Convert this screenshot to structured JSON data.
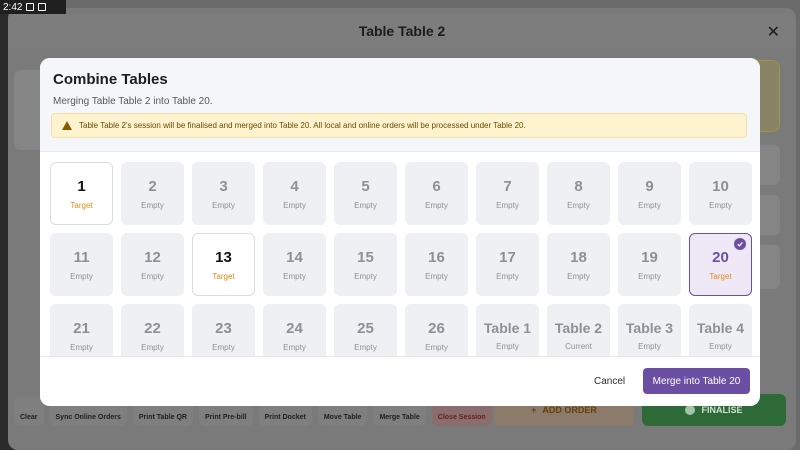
{
  "status_bar": {
    "time": "2:42"
  },
  "app": {
    "title": "Table Table 2",
    "close_icon": "close-icon",
    "toolbar": [
      {
        "name": "clear",
        "label": "Clear"
      },
      {
        "name": "sync-online-orders",
        "label": "Sync Online Orders"
      },
      {
        "name": "print-table-qr",
        "label": "Print Table QR"
      },
      {
        "name": "print-pre-bill",
        "label": "Print Pre-bill"
      },
      {
        "name": "print-docket",
        "label": "Print Docket"
      },
      {
        "name": "move-table",
        "label": "Move Table"
      },
      {
        "name": "merge-table",
        "label": "Merge Table"
      },
      {
        "name": "close-session",
        "label": "Close Session"
      }
    ],
    "add_order": "ADD ORDER",
    "finalise": "FINALISE"
  },
  "modal": {
    "title": "Combine Tables",
    "subtitle": "Merging Table Table 2 into Table 20.",
    "warning": "Table Table 2's session will be finalised and merged into Table 20. All local and online orders will be processed under Table 20.",
    "tables": [
      {
        "name": "1",
        "status": "Target",
        "state": "target"
      },
      {
        "name": "2",
        "status": "Empty",
        "state": "empty"
      },
      {
        "name": "3",
        "status": "Empty",
        "state": "empty"
      },
      {
        "name": "4",
        "status": "Empty",
        "state": "empty"
      },
      {
        "name": "5",
        "status": "Empty",
        "state": "empty"
      },
      {
        "name": "6",
        "status": "Empty",
        "state": "empty"
      },
      {
        "name": "7",
        "status": "Empty",
        "state": "empty"
      },
      {
        "name": "8",
        "status": "Empty",
        "state": "empty"
      },
      {
        "name": "9",
        "status": "Empty",
        "state": "empty"
      },
      {
        "name": "10",
        "status": "Empty",
        "state": "empty"
      },
      {
        "name": "11",
        "status": "Empty",
        "state": "empty"
      },
      {
        "name": "12",
        "status": "Empty",
        "state": "empty"
      },
      {
        "name": "13",
        "status": "Target",
        "state": "target"
      },
      {
        "name": "14",
        "status": "Empty",
        "state": "empty"
      },
      {
        "name": "15",
        "status": "Empty",
        "state": "empty"
      },
      {
        "name": "16",
        "status": "Empty",
        "state": "empty"
      },
      {
        "name": "17",
        "status": "Empty",
        "state": "empty"
      },
      {
        "name": "18",
        "status": "Empty",
        "state": "empty"
      },
      {
        "name": "19",
        "status": "Empty",
        "state": "empty"
      },
      {
        "name": "20",
        "status": "Target",
        "state": "selected"
      },
      {
        "name": "21",
        "status": "Empty",
        "state": "empty"
      },
      {
        "name": "22",
        "status": "Empty",
        "state": "empty"
      },
      {
        "name": "23",
        "status": "Empty",
        "state": "empty"
      },
      {
        "name": "24",
        "status": "Empty",
        "state": "empty"
      },
      {
        "name": "25",
        "status": "Empty",
        "state": "empty"
      },
      {
        "name": "26",
        "status": "Empty",
        "state": "empty"
      },
      {
        "name": "Table 1",
        "status": "Empty",
        "state": "empty"
      },
      {
        "name": "Table 2",
        "status": "Current",
        "state": "current"
      },
      {
        "name": "Table 3",
        "status": "Empty",
        "state": "empty"
      },
      {
        "name": "Table 4",
        "status": "Empty",
        "state": "empty"
      }
    ],
    "cancel_label": "Cancel",
    "merge_label": "Merge into Table 20"
  },
  "colors": {
    "accent": "#6b4fa3",
    "target_text": "#e08b1a",
    "warning_bg": "#fdf3cf",
    "finalise_green": "#2e6a38"
  }
}
